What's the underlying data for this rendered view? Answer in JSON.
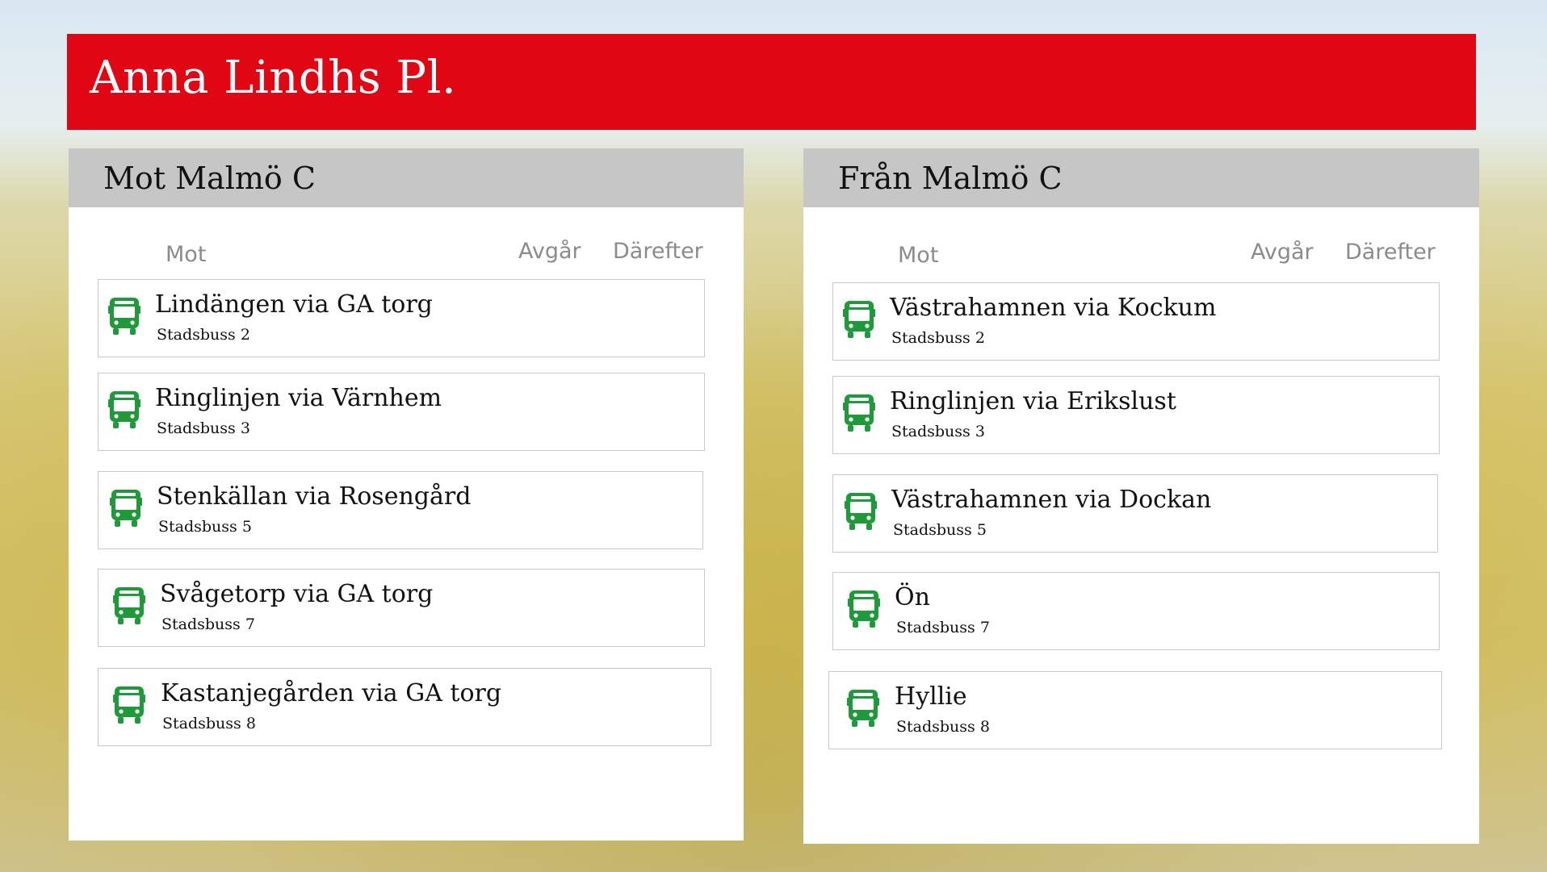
{
  "stop_name": "Anna Lindhs Pl.",
  "accent_color": "#e10613",
  "icon_color": "#1f9a3a",
  "columns": {
    "mot": "Mot",
    "avgar": "Avgår",
    "darefter": "Därefter"
  },
  "left_panel": {
    "title": "Mot Malmö C",
    "departures": [
      {
        "icon": "bus-icon",
        "destination": "Lindängen via GA torg",
        "line": "Stadsbuss 2"
      },
      {
        "icon": "bus-icon",
        "destination": "Ringlinjen via Värnhem",
        "line": "Stadsbuss 3"
      },
      {
        "icon": "bus-icon",
        "destination": "Stenkällan via Rosengård",
        "line": "Stadsbuss 5"
      },
      {
        "icon": "bus-icon",
        "destination": "Svågetorp via GA torg",
        "line": "Stadsbuss 7"
      },
      {
        "icon": "bus-icon",
        "destination": "Kastanjegården via GA torg",
        "line": "Stadsbuss 8"
      }
    ]
  },
  "right_panel": {
    "title": "Från Malmö C",
    "departures": [
      {
        "icon": "bus-icon",
        "destination": "Västrahamnen via Kockum",
        "line": "Stadsbuss 2"
      },
      {
        "icon": "bus-icon",
        "destination": "Ringlinjen via Erikslust",
        "line": "Stadsbuss 3"
      },
      {
        "icon": "bus-icon",
        "destination": "Västrahamnen via Dockan",
        "line": "Stadsbuss 5"
      },
      {
        "icon": "bus-icon",
        "destination": "Ön",
        "line": "Stadsbuss 7"
      },
      {
        "icon": "bus-icon",
        "destination": "Hyllie",
        "line": "Stadsbuss 8"
      }
    ]
  }
}
